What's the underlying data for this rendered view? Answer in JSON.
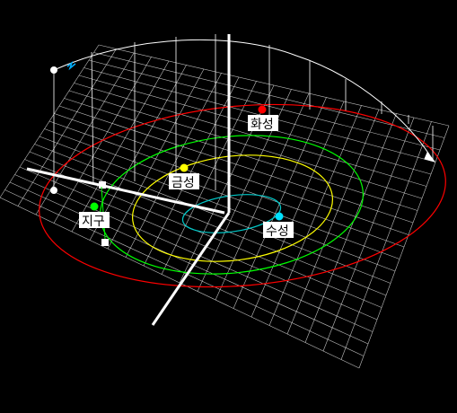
{
  "planets": [
    {
      "id": "mercury",
      "label": "수성",
      "orbit_color": "#00c8c8",
      "dot_color": "#00e0ff"
    },
    {
      "id": "venus",
      "label": "금성",
      "orbit_color": "#ffff00",
      "dot_color": "#ffff00"
    },
    {
      "id": "earth",
      "label": "지구",
      "orbit_color": "#00ff00",
      "dot_color": "#00ff00"
    },
    {
      "id": "mars",
      "label": "화성",
      "orbit_color": "#ff0000",
      "dot_color": "#ff0000"
    }
  ],
  "colors": {
    "background": "#000000",
    "grid": "#ffffff",
    "axes": "#ffffff",
    "trajectory": "#ffffff",
    "label_bg": "#ffffff"
  },
  "icons": {
    "spacecraft": "spacecraft-icon",
    "sun": "sun-origin-icon"
  }
}
